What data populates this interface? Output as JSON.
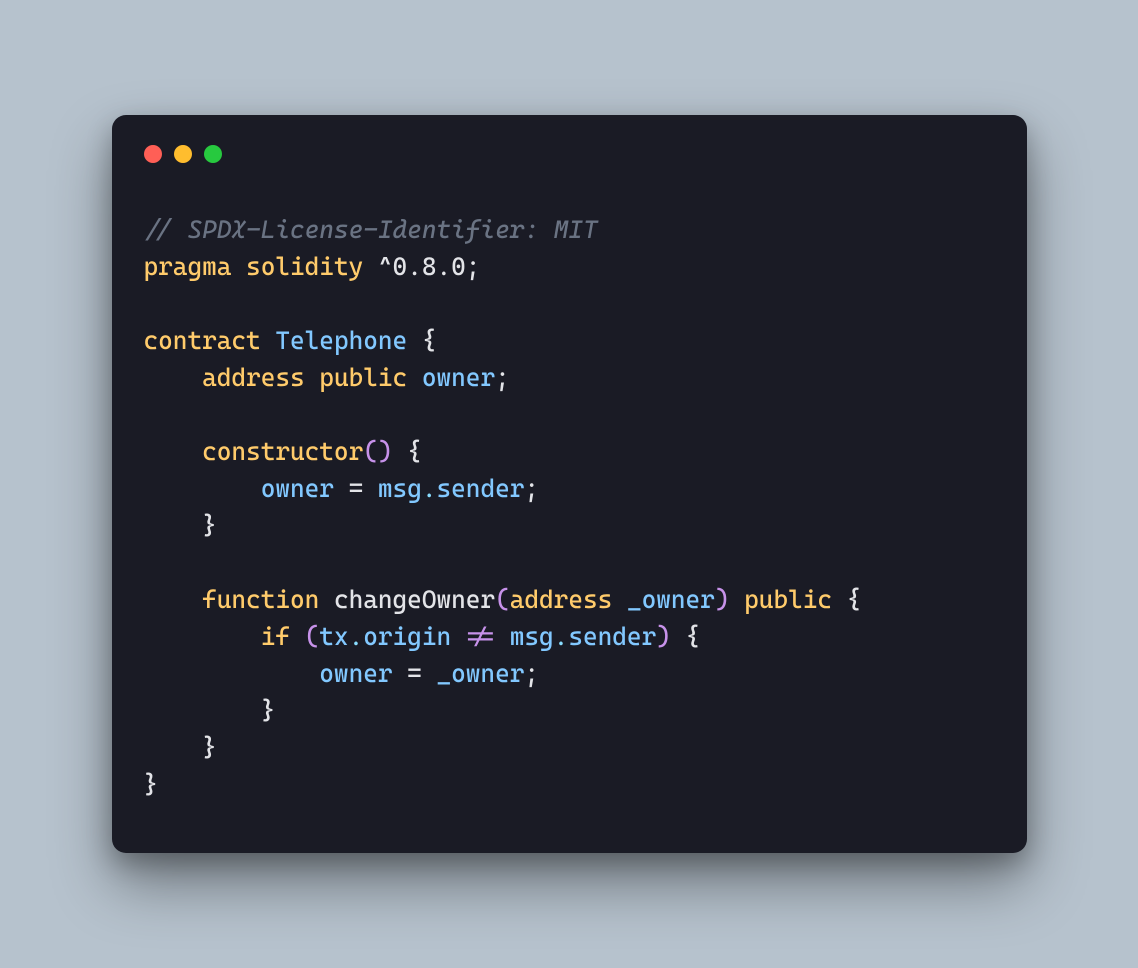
{
  "code": {
    "l1": {
      "comment": "// SPDX-License-Identifier: MIT"
    },
    "l2": {
      "pragma": "pragma",
      "solidity": "solidity",
      "version": "^0.8.0",
      "semi": ";"
    },
    "l4": {
      "contract": "contract",
      "name": "Telephone",
      "brace": " {"
    },
    "l5": {
      "indent": "    ",
      "address": "address",
      "public": "public",
      "owner": "owner",
      "semi": ";"
    },
    "l7": {
      "indent": "    ",
      "constructor": "constructor",
      "paren": "()",
      "brace": " {"
    },
    "l8": {
      "indent": "        ",
      "owner": "owner",
      "eq": " = ",
      "msg": "msg",
      "dot": ".",
      "sender": "sender",
      "semi": ";"
    },
    "l9": {
      "indent": "    ",
      "brace": "}"
    },
    "l11": {
      "indent": "    ",
      "function": "function",
      "name": "changeOwner",
      "lp": "(",
      "address": "address",
      "param": "_owner",
      "rp": ")",
      "public": "public",
      "brace": " {"
    },
    "l12": {
      "indent": "        ",
      "if": "if",
      "lp": " (",
      "tx": "tx",
      "dot1": ".",
      "origin": "origin",
      "neq": " != ",
      "msg": "msg",
      "dot2": ".",
      "sender": "sender",
      "rp": ")",
      "brace": " {"
    },
    "l13": {
      "indent": "            ",
      "owner": "owner",
      "eq": " = ",
      "param": "_owner",
      "semi": ";"
    },
    "l14": {
      "indent": "        ",
      "brace": "}"
    },
    "l15": {
      "indent": "    ",
      "brace": "}"
    },
    "l16": {
      "brace": "}"
    }
  }
}
